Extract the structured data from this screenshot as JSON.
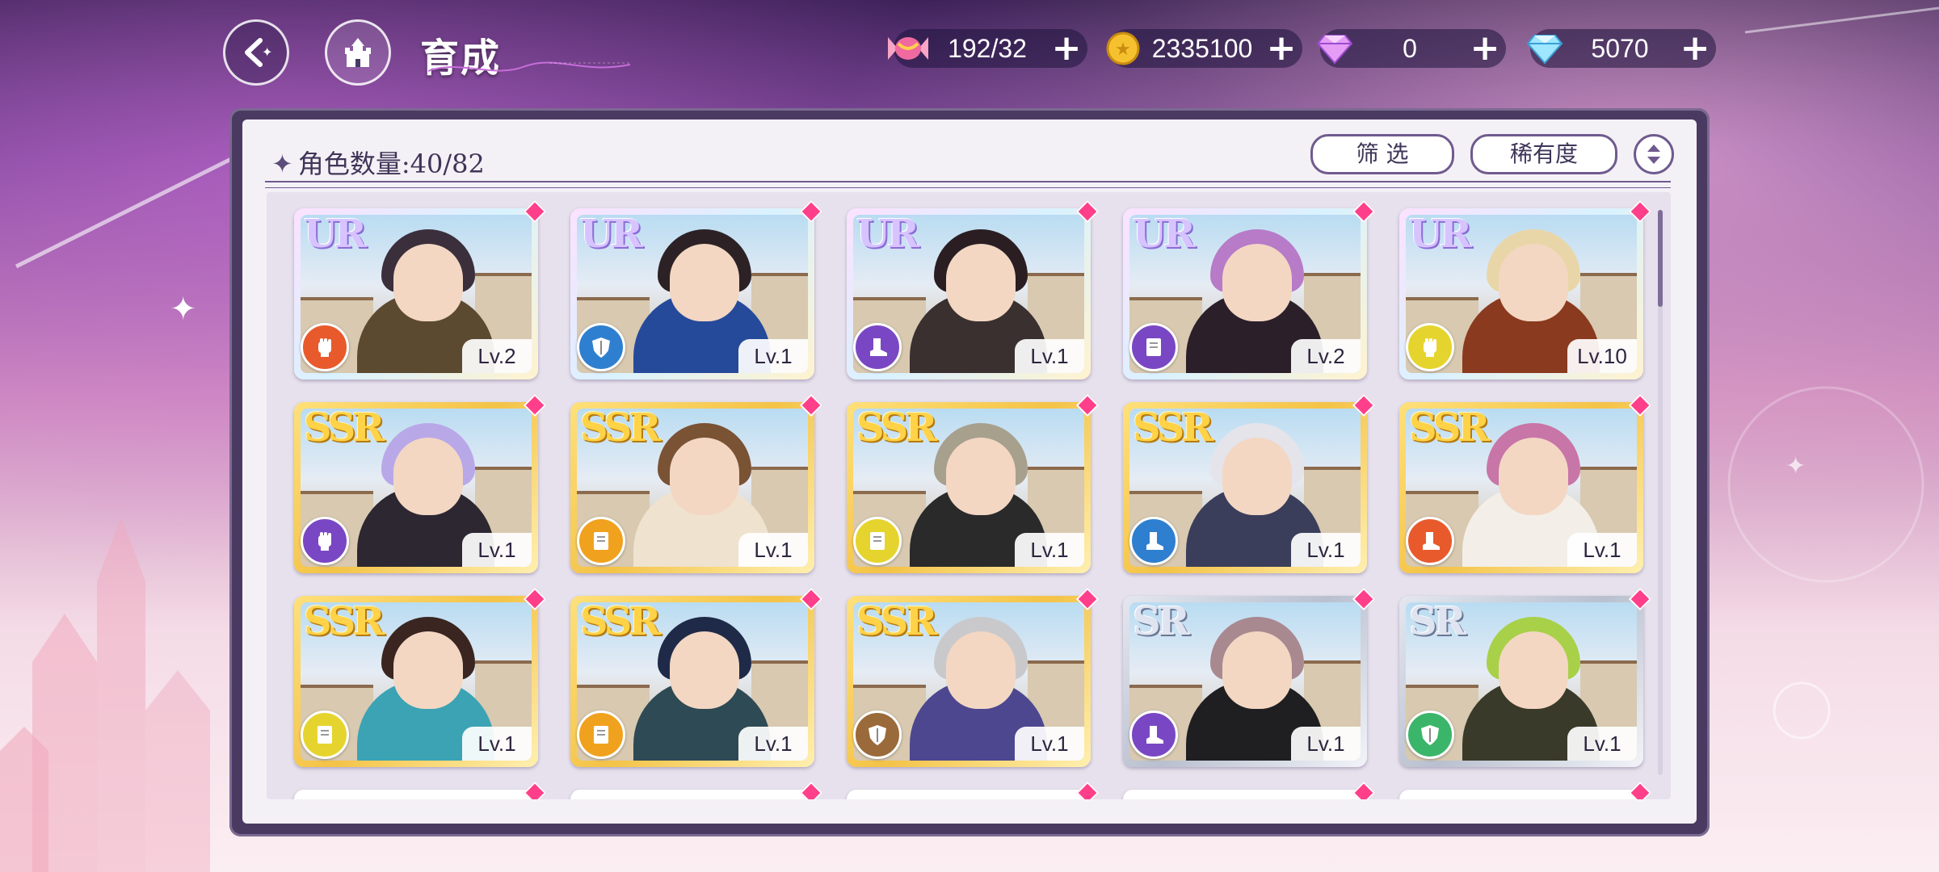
{
  "header": {
    "title": "育成",
    "back_label": "back",
    "home_label": "home"
  },
  "resources": [
    {
      "name": "candy",
      "value": "192/32",
      "icon": "candy-icon",
      "color": "#f06aa0"
    },
    {
      "name": "gold",
      "value": "2335100",
      "icon": "gold-coin-icon",
      "color": "#f6c12f"
    },
    {
      "name": "pink-diamond",
      "value": "0",
      "icon": "pink-diamond-icon",
      "color": "#d06ce8"
    },
    {
      "name": "blue-diamond",
      "value": "5070",
      "icon": "blue-diamond-icon",
      "color": "#7ed6ff"
    }
  ],
  "panel": {
    "count_label": "角色数量:40/82",
    "filter_label": "筛 选",
    "sort_label": "稀有度"
  },
  "cards": [
    {
      "rarity": "UR",
      "level": "Lv.2",
      "type_color": "#e85a2c",
      "type_icon": "fist-icon",
      "hair": "#3b2f3c",
      "outfit": "#5c4a30"
    },
    {
      "rarity": "UR",
      "level": "Lv.1",
      "type_color": "#2f7fd0",
      "type_icon": "shield-icon",
      "hair": "#2c2226",
      "outfit": "#264a9a"
    },
    {
      "rarity": "UR",
      "level": "Lv.1",
      "type_color": "#7a47c4",
      "type_icon": "boot-icon",
      "hair": "#2a1e22",
      "outfit": "#3a3030"
    },
    {
      "rarity": "UR",
      "level": "Lv.2",
      "type_color": "#7a47c4",
      "type_icon": "book-icon",
      "hair": "#b77bc8",
      "outfit": "#2b1f2a"
    },
    {
      "rarity": "UR",
      "level": "Lv.10",
      "type_color": "#e6d42e",
      "type_icon": "fist-icon",
      "hair": "#e9d6a8",
      "outfit": "#8a3a1e"
    },
    {
      "rarity": "SSR",
      "level": "Lv.1",
      "type_color": "#7a47c4",
      "type_icon": "fist-icon",
      "hair": "#b9a8e8",
      "outfit": "#2d2732"
    },
    {
      "rarity": "SSR",
      "level": "Lv.1",
      "type_color": "#f0a21e",
      "type_icon": "book-icon",
      "hair": "#7a5234",
      "outfit": "#efe2cf"
    },
    {
      "rarity": "SSR",
      "level": "Lv.1",
      "type_color": "#e6d42e",
      "type_icon": "book-icon",
      "hair": "#a7a08d",
      "outfit": "#2a2a2a"
    },
    {
      "rarity": "SSR",
      "level": "Lv.1",
      "type_color": "#2f7fd0",
      "type_icon": "boot-icon",
      "hair": "#e4e4ea",
      "outfit": "#3a3e5a"
    },
    {
      "rarity": "SSR",
      "level": "Lv.1",
      "type_color": "#e85a2c",
      "type_icon": "boot-icon",
      "hair": "#c875a8",
      "outfit": "#f3efe8"
    },
    {
      "rarity": "SSR",
      "level": "Lv.1",
      "type_color": "#e6d42e",
      "type_icon": "book-icon",
      "hair": "#3a2520",
      "outfit": "#3ba3b4"
    },
    {
      "rarity": "SSR",
      "level": "Lv.1",
      "type_color": "#f0a21e",
      "type_icon": "book-icon",
      "hair": "#1f2a48",
      "outfit": "#2e4a55"
    },
    {
      "rarity": "SSR",
      "level": "Lv.1",
      "type_color": "#9a6a3a",
      "type_icon": "shield-icon",
      "hair": "#c9c9cc",
      "outfit": "#4d4790"
    },
    {
      "rarity": "SR",
      "level": "Lv.1",
      "type_color": "#7a47c4",
      "type_icon": "boot-icon",
      "hair": "#a88990",
      "outfit": "#1f1f22"
    },
    {
      "rarity": "SR",
      "level": "Lv.1",
      "type_color": "#3bb56a",
      "type_icon": "shield-icon",
      "hair": "#a8d048",
      "outfit": "#3a3a2a"
    }
  ]
}
